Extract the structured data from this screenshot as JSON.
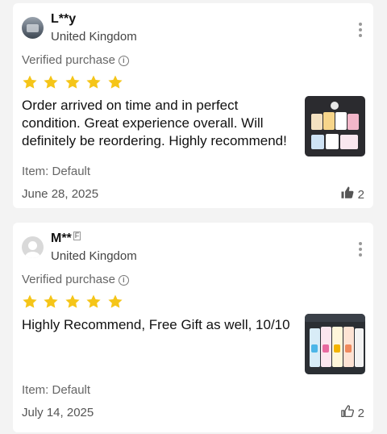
{
  "reviews": [
    {
      "name": "L**y",
      "flag": "",
      "country": "United Kingdom",
      "verified": "Verified purchase",
      "rating": 5,
      "text": "Order arrived on time and in perfect condition. Great experience overall. Will definitely be reordering. Highly recommend!",
      "item": "Item: Default",
      "date": "June 28, 2025",
      "likes": "2",
      "liked": true
    },
    {
      "name": "M**",
      "flag": "F",
      "country": "United Kingdom",
      "verified": "Verified purchase",
      "rating": 5,
      "text": "Highly Recommend, Free Gift as well, 10/10",
      "item": "Item: Default",
      "date": "July 14, 2025",
      "likes": "2",
      "liked": false
    }
  ],
  "colors": {
    "star": "#f5c518",
    "card": "#ffffff",
    "background": "#f3f3f3"
  },
  "icons": [
    "more-vertical-icon",
    "info-icon",
    "star-icon",
    "thumbs-up-icon"
  ]
}
